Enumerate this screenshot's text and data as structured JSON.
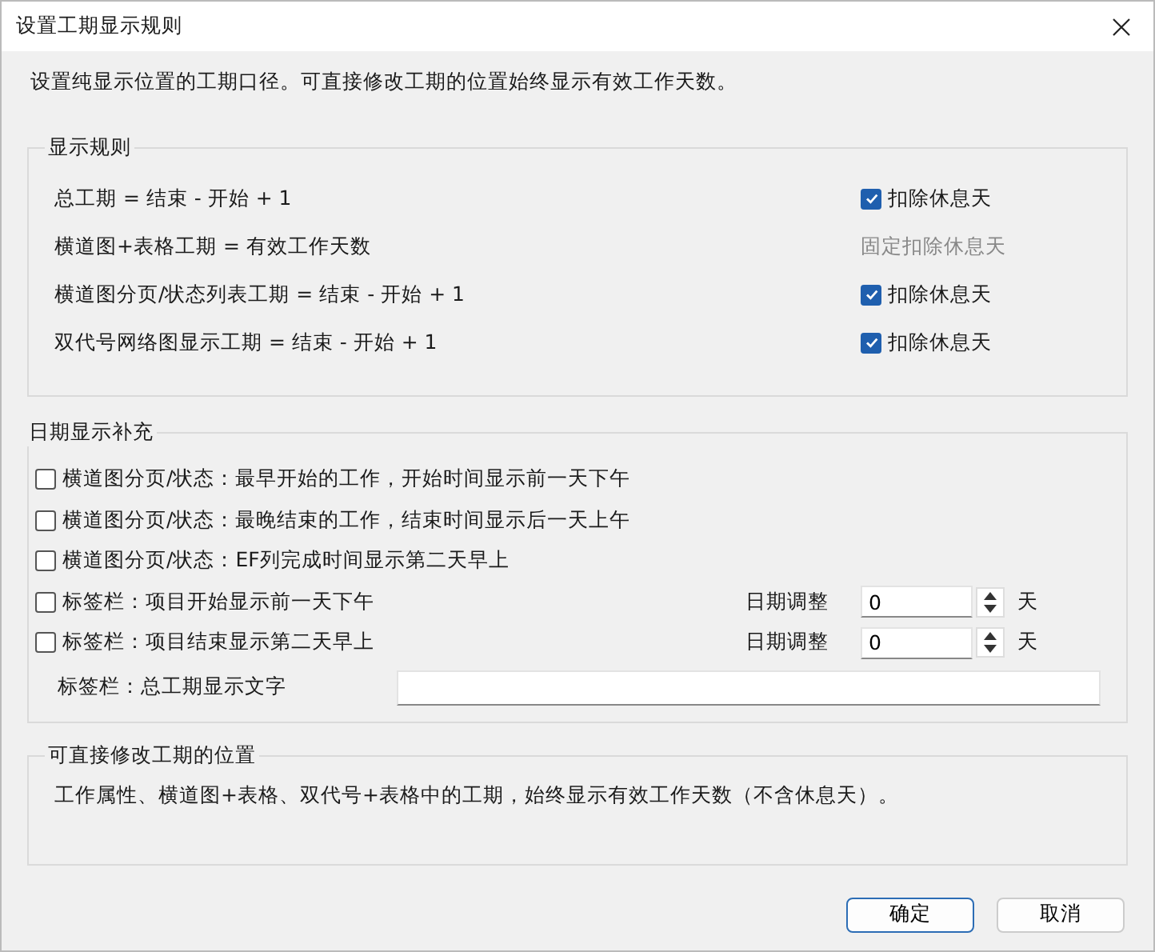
{
  "window": {
    "title": "设置工期显示规则"
  },
  "intro": "设置纯显示位置的工期口径。可直接修改工期的位置始终显示有效工作天数。",
  "rules": {
    "title": "显示规则",
    "rows": [
      {
        "label": "总工期 = 结束 - 开始 + 1",
        "kind": "checkbox",
        "option": "扣除休息天",
        "checked": true
      },
      {
        "label": "横道图+表格工期 = 有效工作天数",
        "kind": "fixed",
        "option": "固定扣除休息天"
      },
      {
        "label": "横道图分页/状态列表工期 = 结束 - 开始 + 1",
        "kind": "checkbox",
        "option": "扣除休息天",
        "checked": true
      },
      {
        "label": "双代号网络图显示工期 = 结束 - 开始 + 1",
        "kind": "checkbox",
        "option": "扣除休息天",
        "checked": true
      }
    ]
  },
  "supplement": {
    "title": "日期显示补充",
    "rows": [
      {
        "label": "横道图分页/状态：最早开始的工作，开始时间显示前一天下午",
        "checked": false
      },
      {
        "label": "横道图分页/状态：最晚结束的工作，结束时间显示后一天上午",
        "checked": false
      },
      {
        "label": "横道图分页/状态：EF列完成时间显示第二天早上",
        "checked": false
      },
      {
        "label": "标签栏：项目开始显示前一天下午",
        "checked": false,
        "adjust": {
          "label": "日期调整",
          "value": "0",
          "unit": "天"
        }
      },
      {
        "label": "标签栏：项目结束显示第二天早上",
        "checked": false,
        "adjust": {
          "label": "日期调整",
          "value": "0",
          "unit": "天"
        }
      }
    ],
    "text_field": {
      "label": "标签栏：总工期显示文字"
    }
  },
  "positions": {
    "title": "可直接修改工期的位置",
    "text": "工作属性、横道图+表格、双代号+表格中的工期，始终显示有效工作天数（不含休息天）。"
  },
  "buttons": [
    {
      "label": "确定",
      "default": true
    },
    {
      "label": "取消",
      "default": false
    }
  ]
}
